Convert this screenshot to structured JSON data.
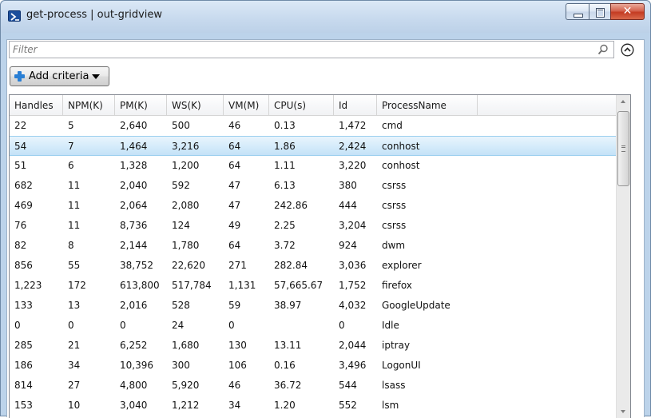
{
  "window": {
    "title": "get-process | out-gridview"
  },
  "filter": {
    "placeholder": "Filter",
    "value": ""
  },
  "toolbar": {
    "add_criteria_label": "Add criteria"
  },
  "icons": {
    "app": "powershell-icon",
    "search": "search-icon",
    "collapse": "chevron-up-circle-icon",
    "add": "plus-icon",
    "dropdown": "caret-down-icon"
  },
  "colors": {
    "selection": "#cfe7f8",
    "add_icon": "#2a7fd4",
    "close_button": "#c43b22"
  },
  "grid": {
    "columns": [
      "Handles",
      "NPM(K)",
      "PM(K)",
      "WS(K)",
      "VM(M)",
      "CPU(s)",
      "Id",
      "ProcessName"
    ],
    "selected_row": 1,
    "rows": [
      [
        "22",
        "5",
        "2,640",
        "500",
        "46",
        "0.13",
        "1,472",
        "cmd"
      ],
      [
        "54",
        "7",
        "1,464",
        "3,216",
        "64",
        "1.86",
        "2,424",
        "conhost"
      ],
      [
        "51",
        "6",
        "1,328",
        "1,200",
        "64",
        "1.11",
        "3,220",
        "conhost"
      ],
      [
        "682",
        "11",
        "2,040",
        "592",
        "47",
        "6.13",
        "380",
        "csrss"
      ],
      [
        "469",
        "11",
        "2,064",
        "2,080",
        "47",
        "242.86",
        "444",
        "csrss"
      ],
      [
        "76",
        "11",
        "8,736",
        "124",
        "49",
        "2.25",
        "3,204",
        "csrss"
      ],
      [
        "82",
        "8",
        "2,144",
        "1,780",
        "64",
        "3.72",
        "924",
        "dwm"
      ],
      [
        "856",
        "55",
        "38,752",
        "22,620",
        "271",
        "282.84",
        "3,036",
        "explorer"
      ],
      [
        "1,223",
        "172",
        "613,800",
        "517,784",
        "1,131",
        "57,665.67",
        "1,752",
        "firefox"
      ],
      [
        "133",
        "13",
        "2,016",
        "528",
        "59",
        "38.97",
        "4,032",
        "GoogleUpdate"
      ],
      [
        "0",
        "0",
        "0",
        "24",
        "0",
        "",
        "0",
        "Idle"
      ],
      [
        "285",
        "21",
        "6,252",
        "1,680",
        "130",
        "13.11",
        "2,044",
        "iptray"
      ],
      [
        "186",
        "34",
        "10,396",
        "300",
        "106",
        "0.16",
        "3,496",
        "LogonUI"
      ],
      [
        "814",
        "27",
        "4,800",
        "5,920",
        "46",
        "36.72",
        "544",
        "lsass"
      ],
      [
        "153",
        "10",
        "3,040",
        "1,212",
        "34",
        "1.20",
        "552",
        "lsm"
      ]
    ]
  }
}
